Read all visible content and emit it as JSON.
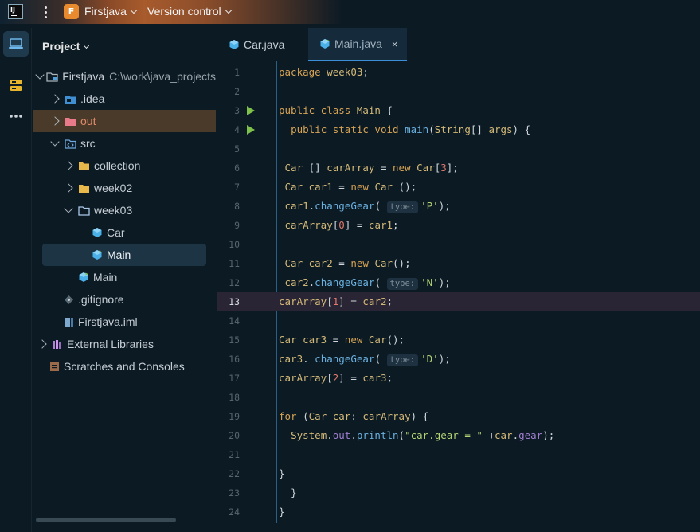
{
  "titlebar": {
    "project_badge": "F",
    "project_name": "Firstjava",
    "vcs_label": "Version control"
  },
  "project_panel": {
    "title": "Project",
    "tree": [
      {
        "label": "Firstjava",
        "path": "C:\\work\\java_projects",
        "expand": "down",
        "icon": "folder-module-icon"
      },
      {
        "label": ".idea",
        "expand": "right",
        "icon": "folder-idea-icon"
      },
      {
        "label": "out",
        "expand": "right",
        "icon": "folder-excluded-icon"
      },
      {
        "label": "src",
        "expand": "down",
        "icon": "folder-source-icon"
      },
      {
        "label": "collection",
        "expand": "right",
        "icon": "folder-icon"
      },
      {
        "label": "week02",
        "expand": "right",
        "icon": "folder-icon"
      },
      {
        "label": "week03",
        "expand": "down",
        "icon": "folder-open-icon"
      },
      {
        "label": "Car",
        "icon": "java-class-icon"
      },
      {
        "label": "Main",
        "icon": "java-main-class-icon"
      },
      {
        "label": "Main",
        "icon": "java-main-class-icon"
      },
      {
        "label": ".gitignore",
        "icon": "gitignore-file-icon"
      },
      {
        "label": "Firstjava.iml",
        "icon": "iml-file-icon"
      },
      {
        "label": "External Libraries",
        "expand": "right",
        "icon": "libraries-icon"
      },
      {
        "label": "Scratches and Consoles",
        "icon": "scratches-icon"
      }
    ]
  },
  "editor": {
    "tabs": [
      {
        "label": "Car.java",
        "active": false
      },
      {
        "label": "Main.java",
        "active": true,
        "close": "×"
      }
    ],
    "current_line": 13,
    "inlay_hint": "type:",
    "lines": [
      {
        "n": "1",
        "code": "package week03;"
      },
      {
        "n": "2",
        "code": ""
      },
      {
        "n": "3",
        "code": "public class Main {",
        "run": true
      },
      {
        "n": "4",
        "code": "  public static void main(String[] args) {",
        "run": true
      },
      {
        "n": "5",
        "code": ""
      },
      {
        "n": "6",
        "code": " Car [] carArray = new Car[3];"
      },
      {
        "n": "7",
        "code": " Car car1 = new Car ();"
      },
      {
        "n": "8",
        "code": " car1.changeGear( type: 'P');"
      },
      {
        "n": "9",
        "code": " carArray[0] = car1;"
      },
      {
        "n": "10",
        "code": ""
      },
      {
        "n": "11",
        "code": " Car car2 = new Car();"
      },
      {
        "n": "12",
        "code": " car2.changeGear( type: 'N');"
      },
      {
        "n": "13",
        "code": "carArray[1] = car2;"
      },
      {
        "n": "14",
        "code": ""
      },
      {
        "n": "15",
        "code": "Car car3 = new Car();"
      },
      {
        "n": "16",
        "code": "car3. changeGear( type: 'D');"
      },
      {
        "n": "17",
        "code": "carArray[2] = car3;"
      },
      {
        "n": "18",
        "code": ""
      },
      {
        "n": "19",
        "code": "for (Car car: carArray) {"
      },
      {
        "n": "20",
        "code": "  System.out.println(\"car.gear = \" +car.gear);"
      },
      {
        "n": "21",
        "code": ""
      },
      {
        "n": "22",
        "code": "}"
      },
      {
        "n": "23",
        "code": "  }"
      },
      {
        "n": "24",
        "code": "}"
      }
    ]
  },
  "colors": {
    "background": "#0c1a24",
    "keyword": "#d6a354",
    "method": "#6ab0de",
    "string": "#b4d474",
    "number": "#e0786b",
    "run_icon": "#7ec24b",
    "accent": "#3b8fd9"
  }
}
